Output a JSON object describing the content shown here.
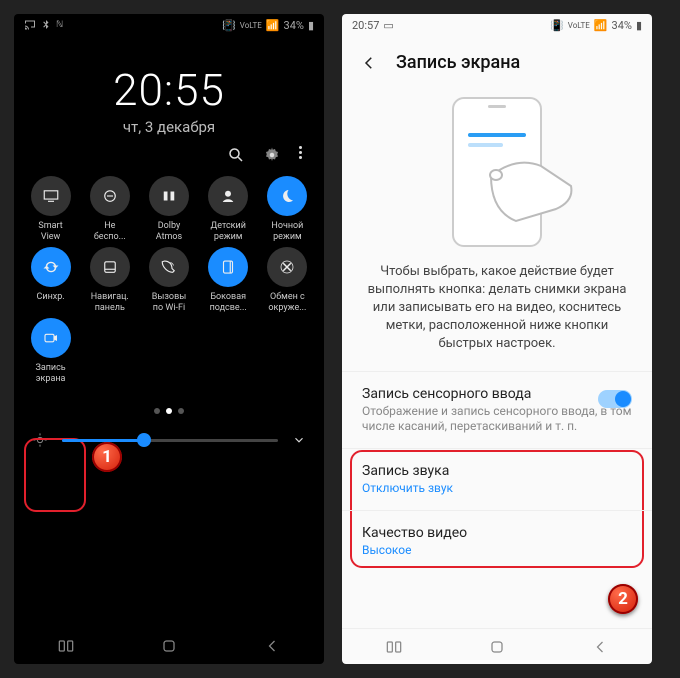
{
  "left": {
    "status": {
      "battery": "34%"
    },
    "clock": {
      "time": "20:55",
      "date": "чт, 3 декабря"
    },
    "tiles": [
      {
        "id": "smart-view",
        "label": "Smart\nView",
        "active": false
      },
      {
        "id": "do-not",
        "label": "Не\nбеспо...",
        "active": false
      },
      {
        "id": "dolby",
        "label": "Dolby\nAtmos",
        "active": false
      },
      {
        "id": "kids",
        "label": "Детский\nрежим",
        "active": false
      },
      {
        "id": "night",
        "label": "Ночной\nрежим",
        "active": true
      },
      {
        "id": "sync",
        "label": "Синхр.",
        "active": true
      },
      {
        "id": "navpanel",
        "label": "Навигац.\nпанель",
        "active": false
      },
      {
        "id": "wifi-call",
        "label": "Вызовы\nпо Wi-Fi",
        "active": false
      },
      {
        "id": "edge",
        "label": "Боковая\nподсве...",
        "active": true
      },
      {
        "id": "nearby",
        "label": "Обмен с\nокруже...",
        "active": false
      },
      {
        "id": "rec",
        "label": "Запись\nэкрана",
        "active": true
      }
    ],
    "marker": "1"
  },
  "right": {
    "status": {
      "time": "20:57",
      "battery": "34%"
    },
    "appbar_title": "Запись экрана",
    "description": "Чтобы выбрать, какое действие будет выполнять кнопка: делать снимки экрана или записывать его на видео, коснитесь метки, расположенной ниже кнопки быстрых настроек.",
    "settings": [
      {
        "title": "Запись сенсорного ввода",
        "sub": "Отображение и запись сенсорного ввода, в том числе касаний, перетаскиваний и т. п.",
        "toggle": true
      },
      {
        "title": "Запись звука",
        "sub": "Отключить звук"
      },
      {
        "title": "Качество видео",
        "sub": "Высокое"
      }
    ],
    "marker": "2"
  }
}
